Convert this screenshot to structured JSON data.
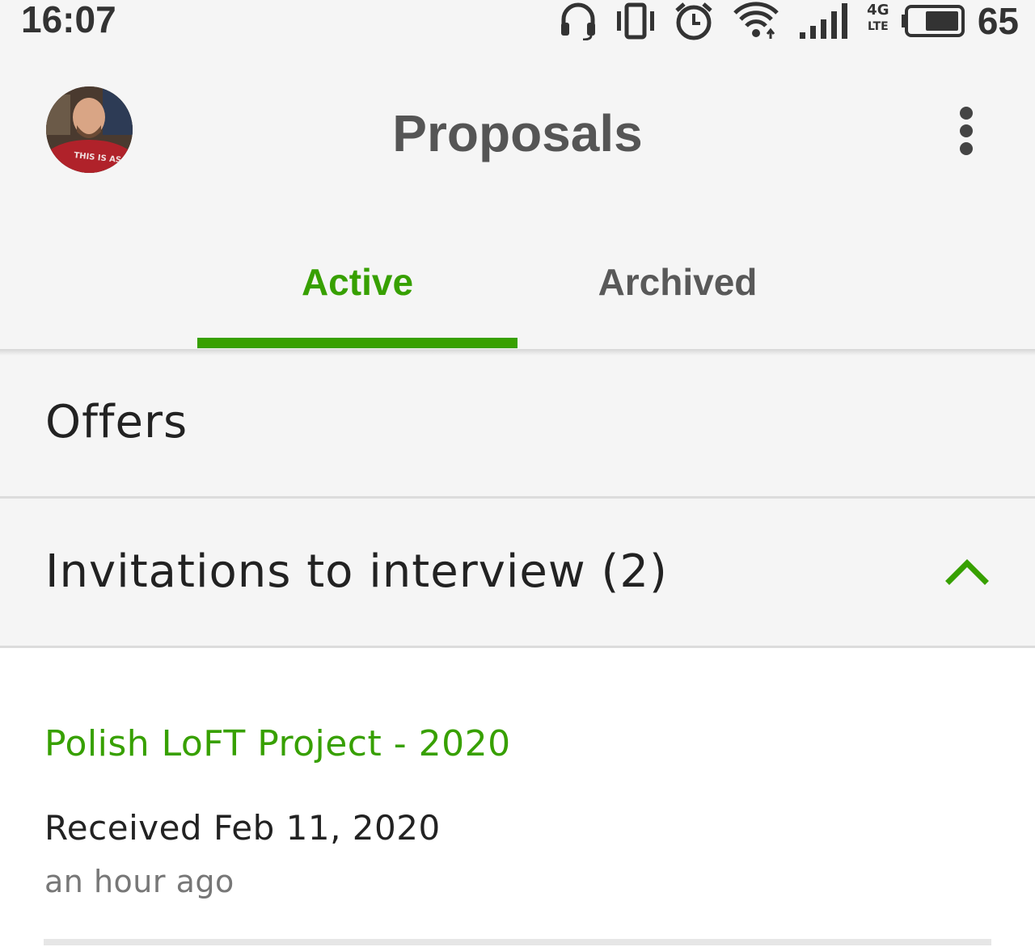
{
  "status_bar": {
    "time": "16:07",
    "battery_percent": "65",
    "network_label_top": "4G",
    "network_label_bottom": "LTE",
    "icons": [
      "headset-icon",
      "vibrate-icon",
      "alarm-icon",
      "wifi-icon",
      "signal-icon",
      "network-type-icon",
      "battery-icon"
    ]
  },
  "header": {
    "title": "Proposals",
    "avatar_shirt_text": "THIS IS AS",
    "menu_icon": "more-vert-icon"
  },
  "tabs": [
    {
      "label": "Active",
      "selected": true
    },
    {
      "label": "Archived",
      "selected": false
    }
  ],
  "sections": {
    "offers": {
      "title": "Offers"
    },
    "invitations": {
      "title": "Invitations to interview (2)",
      "expanded": true,
      "icon": "chevron-up-icon"
    }
  },
  "invitations": [
    {
      "job_title": "Polish LoFT Project - 2020",
      "received": "Received Feb 11, 2020",
      "time_ago": "an hour ago"
    }
  ],
  "colors": {
    "accent": "#37a000",
    "background": "#f5f5f5",
    "card": "#ffffff"
  }
}
